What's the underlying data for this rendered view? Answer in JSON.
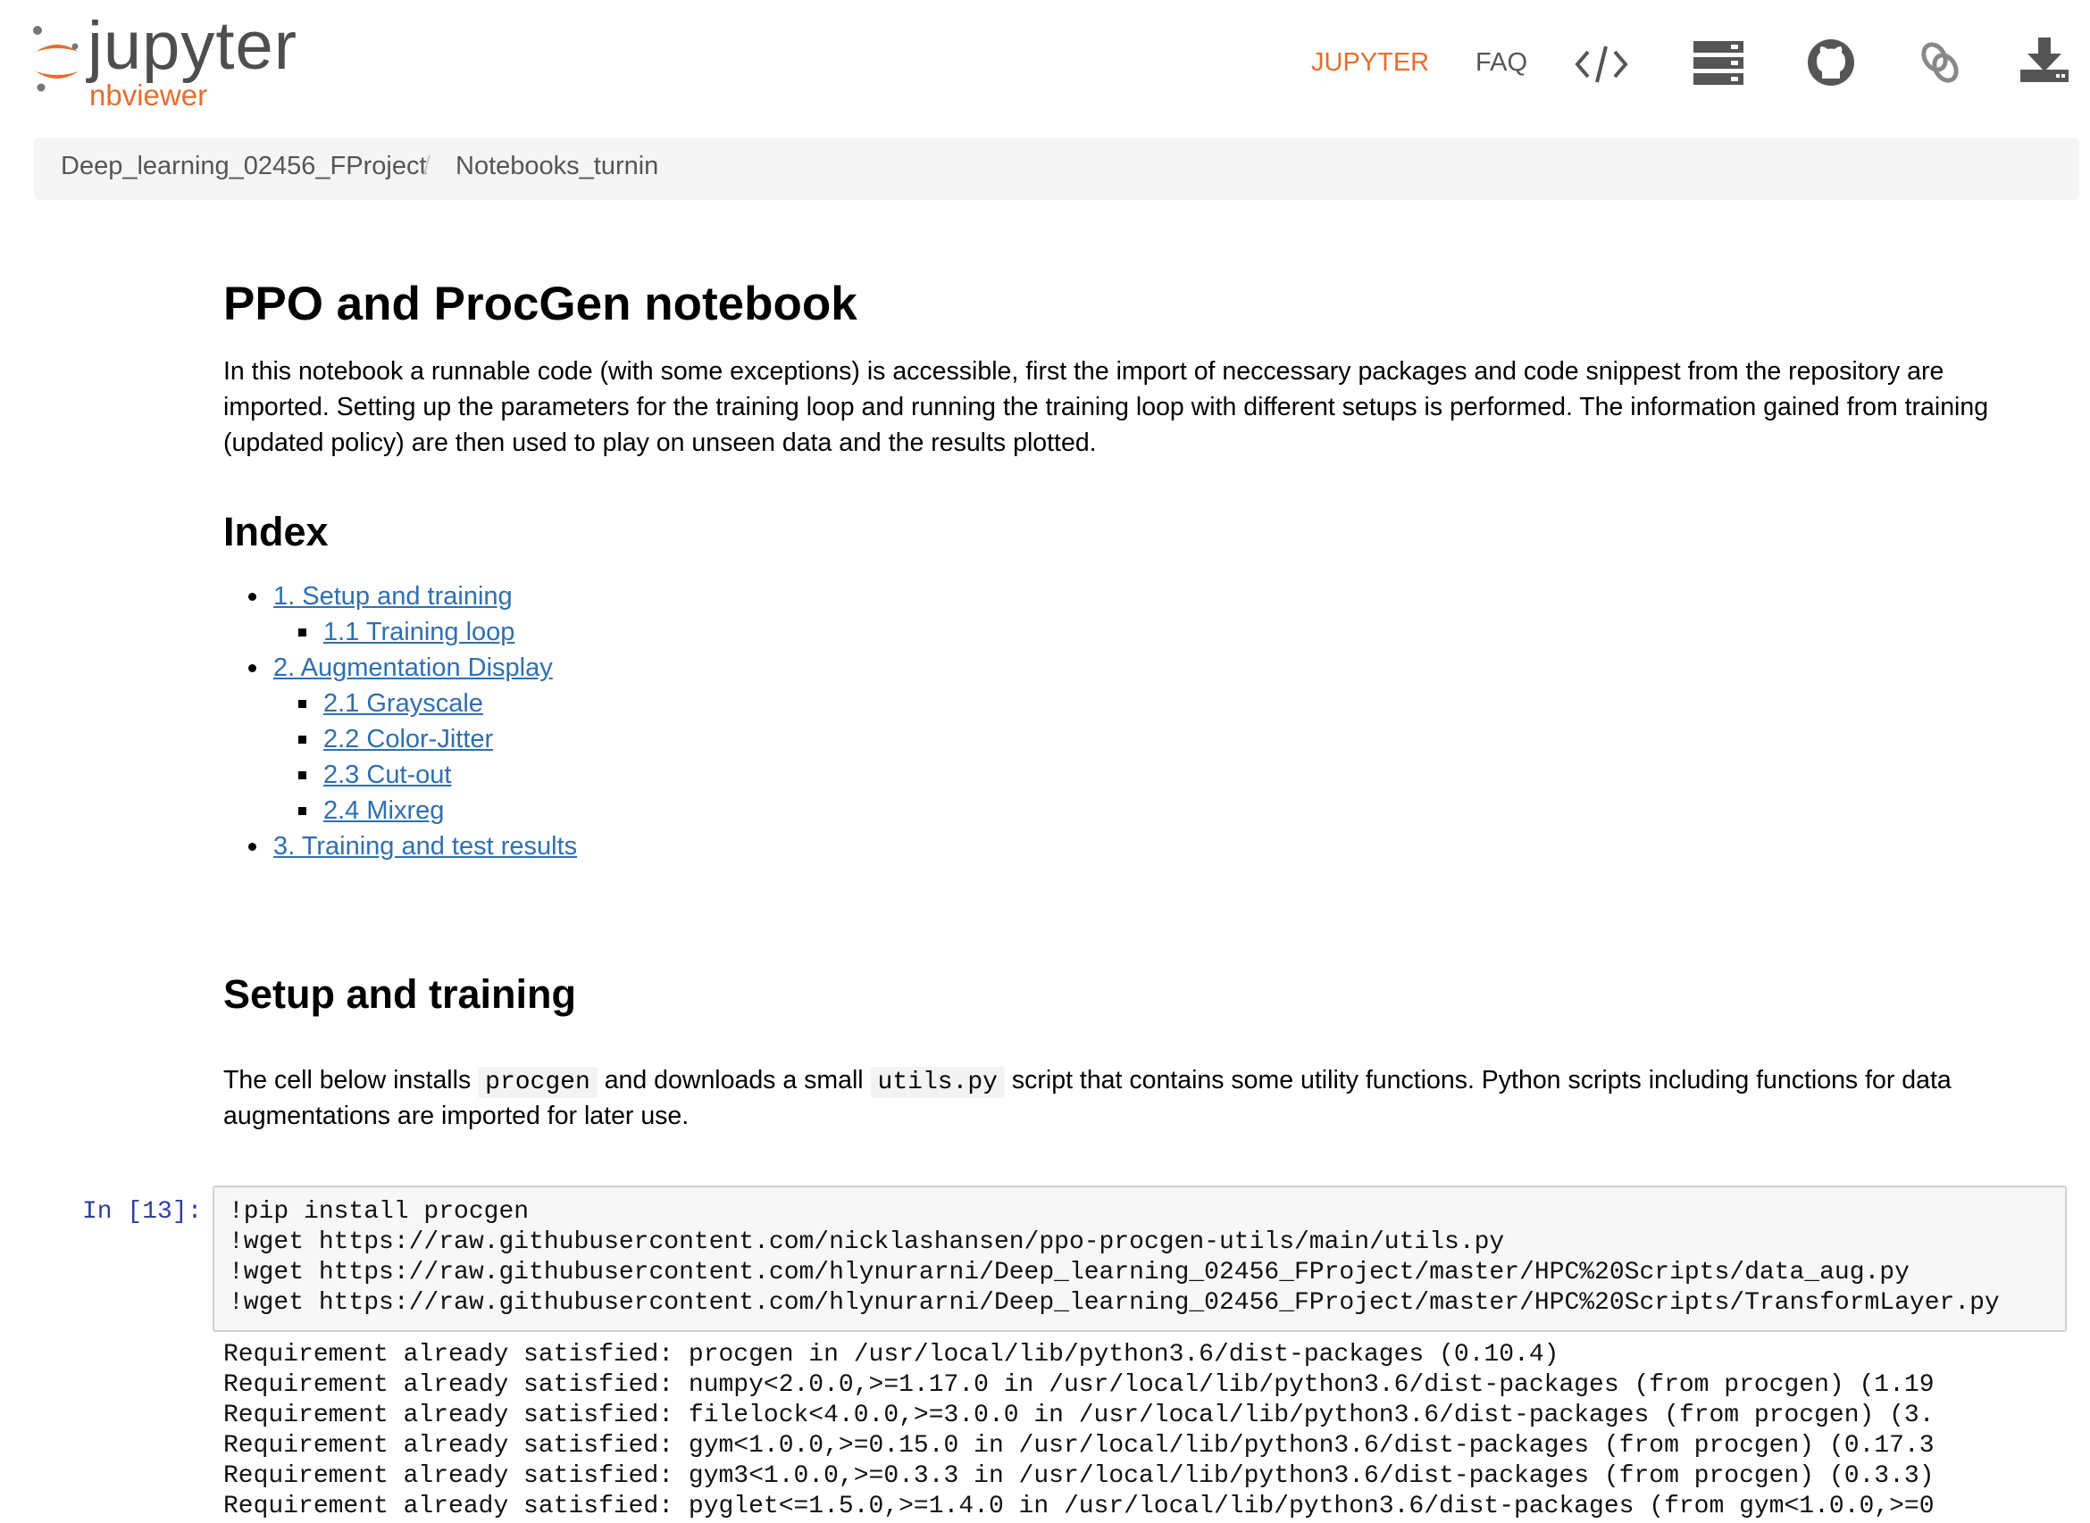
{
  "brand": {
    "name": "jupyter",
    "sub": "nbviewer"
  },
  "nav": {
    "jupyter_label": "JUPYTER",
    "faq_label": "FAQ",
    "icons": [
      "code-icon",
      "server-icon",
      "github-icon",
      "link-icon",
      "download-icon"
    ]
  },
  "breadcrumb": [
    "Deep_learning_02456_FProject",
    "Notebooks_turnin"
  ],
  "notebook": {
    "title": "PPO and ProcGen notebook",
    "intro": [
      "In this notebook a runnable code (with some exceptions) is accessible, first the import of neccessary packages and code snippest from the repository are",
      "imported. Setting up the parameters for the training loop and running the training loop with different setups is performed. The information gained from training",
      "(updated policy) are then used to play on unseen data and the results plotted."
    ],
    "index_heading": "Index",
    "index": {
      "i1": "1. Setup and training",
      "i1_1": "1.1 Training loop",
      "i2": "2. Augmentation Display",
      "i2_1": "2.1 Grayscale",
      "i2_2": "2.2 Color-Jitter",
      "i2_3": "2.3 Cut-out",
      "i2_4": "2.4 Mixreg",
      "i3": "3. Training and test results"
    },
    "setup_heading": "Setup and training",
    "setup_text": {
      "a": "The cell below installs",
      "code1": "procgen",
      "b": "and downloads a small",
      "code2": "utils.py",
      "c": "script that contains some utility functions. Python scripts including functions for data",
      "line2": "augmentations are imported for later use."
    }
  },
  "cell": {
    "prompt": "In [13]:",
    "code": [
      "!pip install procgen",
      "!wget https://raw.githubusercontent.com/nicklashansen/ppo-procgen-utils/main/utils.py",
      "!wget https://raw.githubusercontent.com/hlynurarni/Deep_learning_02456_FProject/master/HPC%20Scripts/data_aug.py",
      "!wget https://raw.githubusercontent.com/hlynurarni/Deep_learning_02456_FProject/master/HPC%20Scripts/TransformLayer.py"
    ],
    "output": [
      "Requirement already satisfied: procgen in /usr/local/lib/python3.6/dist-packages (0.10.4)",
      "Requirement already satisfied: numpy<2.0.0,>=1.17.0 in /usr/local/lib/python3.6/dist-packages (from procgen) (1.19",
      "Requirement already satisfied: filelock<4.0.0,>=3.0.0 in /usr/local/lib/python3.6/dist-packages (from procgen) (3.",
      "Requirement already satisfied: gym<1.0.0,>=0.15.0 in /usr/local/lib/python3.6/dist-packages (from procgen) (0.17.3",
      "Requirement already satisfied: gym3<1.0.0,>=0.3.3 in /usr/local/lib/python3.6/dist-packages (from procgen) (0.3.3)",
      "Requirement already satisfied: pyglet<=1.5.0,>=1.4.0 in /usr/local/lib/python3.6/dist-packages (from gym<1.0.0,>=0"
    ]
  },
  "colors": {
    "brand_orange": "#e46e2e",
    "link_blue": "#2f6fb0",
    "prompt_blue": "#303f9f"
  }
}
